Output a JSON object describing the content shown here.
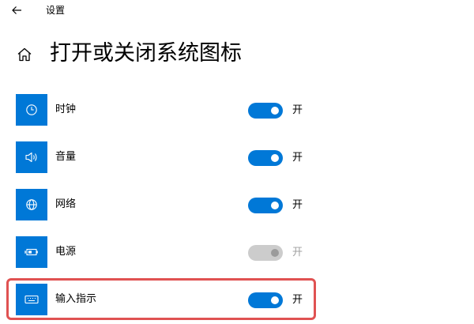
{
  "header": {
    "app_title": "设置",
    "back_icon": "back-arrow-icon"
  },
  "page": {
    "home_icon": "home-icon",
    "title": "打开或关闭系统图标"
  },
  "rows": [
    {
      "label": "时钟",
      "icon": "clock-icon",
      "state": "开",
      "on": true,
      "enabled": true
    },
    {
      "label": "音量",
      "icon": "speaker-icon",
      "state": "开",
      "on": true,
      "enabled": true
    },
    {
      "label": "网络",
      "icon": "globe-icon",
      "state": "开",
      "on": true,
      "enabled": true
    },
    {
      "label": "电源",
      "icon": "battery-icon",
      "state": "开",
      "on": true,
      "enabled": false
    },
    {
      "label": "输入指示",
      "icon": "keyboard-icon",
      "state": "开",
      "on": true,
      "enabled": true,
      "highlighted": true
    }
  ],
  "colors": {
    "accent": "#0078d7",
    "disabled_toggle": "#cccccc",
    "highlight_border": "#e05252"
  }
}
